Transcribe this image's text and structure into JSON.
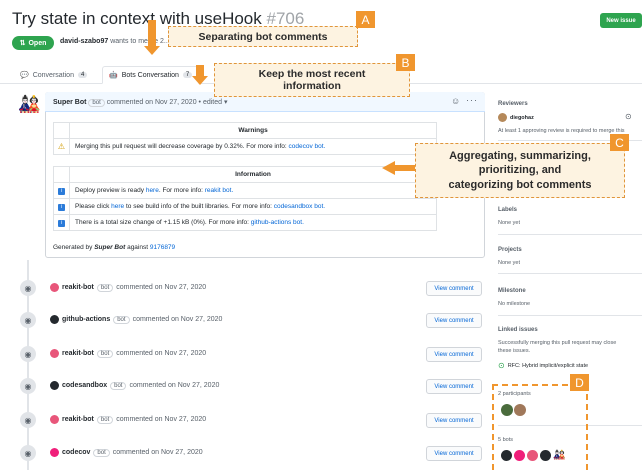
{
  "header": {
    "title": "Try state in context with useHook",
    "number": "#706",
    "new_issue": "New issue",
    "state": "Open",
    "author": "david-szabo97",
    "meta_rest": "wants to merge 2..."
  },
  "tabs": [
    {
      "label": "Conversation",
      "count": "4"
    },
    {
      "label": "Bots Conversation",
      "count": "7"
    }
  ],
  "comment": {
    "author": "Super Bot",
    "label": "bot",
    "time": "commented on Nov 27, 2020",
    "edited": "• edited",
    "warnings_header": "Warnings",
    "warning_text": "Merging this pull request will decrease coverage by 0.32%. For more info:",
    "warning_link": "codecov bot.",
    "info_header": "Information",
    "info": [
      {
        "text": "Deploy preview is ready",
        "link1": "here",
        "mid": ". For more info:",
        "link2": "reakit bot."
      },
      {
        "text": "Please click",
        "link1": "here",
        "mid": "to see build info of the built libraries. For more info:",
        "link2": "codesandbox bot."
      },
      {
        "text": "There is a total size change of +1.15 kB (0%). For more info:",
        "link1": "",
        "mid": "",
        "link2": "github-actions bot."
      }
    ],
    "generated_prefix": "Generated by",
    "generated_by": "Super Bot",
    "generated_against": "against",
    "commit": "9176879"
  },
  "timeline": [
    {
      "bot": "reakit-bot",
      "label": "bot",
      "time": "commented on Nov 27, 2020",
      "btn": "View comment",
      "color": "#e8567a"
    },
    {
      "bot": "github-actions",
      "label": "bot",
      "time": "commented on Nov 27, 2020",
      "btn": "View comment",
      "color": "#24292e"
    },
    {
      "bot": "reakit-bot",
      "label": "bot",
      "time": "commented on Nov 27, 2020",
      "btn": "View comment",
      "color": "#e8567a"
    },
    {
      "bot": "codesandbox",
      "label": "bot",
      "time": "commented on Nov 27, 2020",
      "btn": "View comment",
      "color": "#24292e"
    },
    {
      "bot": "reakit-bot",
      "label": "bot",
      "time": "commented on Nov 27, 2020",
      "btn": "View comment",
      "color": "#e8567a"
    },
    {
      "bot": "codecov",
      "label": "bot",
      "time": "commented on Nov 27, 2020",
      "btn": "View comment",
      "color": "#f01f7a"
    }
  ],
  "sidebar": {
    "reviewers_title": "Reviewers",
    "reviewer": "diegohaz",
    "reviewer_note": "At least 1 approving review is required to merge this",
    "labels_title": "Labels",
    "labels_value": "None yet",
    "projects_title": "Projects",
    "projects_value": "None yet",
    "milestone_title": "Milestone",
    "milestone_value": "No milestone",
    "linked_title": "Linked issues",
    "linked_note1": "Successfully merging this pull request may close",
    "linked_note2": "these issues.",
    "linked_issue": "RFC: Hybrid implicit/explicit state",
    "participants": "2 participants",
    "bots": "5 bots"
  },
  "callouts": {
    "a_letter": "A",
    "a_text": "Separating bot comments",
    "b_letter": "B",
    "b_text1": "Keep the most recent",
    "b_text2": "information",
    "c_letter": "C",
    "c_text1": "Aggregating, summarizing,",
    "c_text2": "prioritizing, and",
    "c_text3": "categorizing bot comments",
    "d_letter": "D"
  },
  "colors": {
    "accent": "#f0962e",
    "green": "#2ea44f",
    "link": "#0366d6"
  }
}
